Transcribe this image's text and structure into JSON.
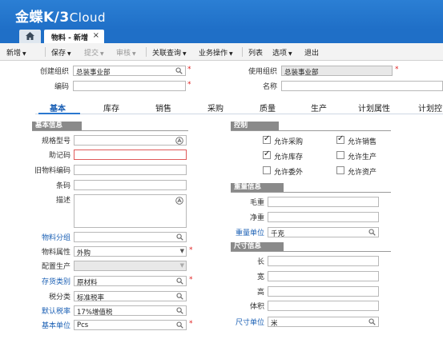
{
  "app": {
    "brand": "金蝶K/3",
    "brand_suffix": "Cloud"
  },
  "tabs": {
    "doc_tab_label": "物料 - 新增",
    "close": "×"
  },
  "toolbar": {
    "items": [
      "新增",
      "保存",
      "提交",
      "审核",
      "关联查询",
      "业务操作",
      "列表",
      "选项",
      "退出"
    ]
  },
  "header": {
    "create_org_label": "创建组织",
    "create_org_value": "总装事业部",
    "use_org_label": "使用组织",
    "use_org_value": "总装事业部",
    "code_label": "编码",
    "code_value": "",
    "name_label": "名称",
    "name_value": ""
  },
  "form_tabs": [
    "基本",
    "库存",
    "销售",
    "采购",
    "质量",
    "生产",
    "计划属性",
    "计划控"
  ],
  "basic": {
    "section_title": "基本信息",
    "spec_label": "规格型号",
    "spec_value": "",
    "mnemonic_label": "助记码",
    "mnemonic_value": "",
    "old_code_label": "旧物料编码",
    "old_code_value": "",
    "barcode_label": "条码",
    "barcode_value": "",
    "desc_label": "描述",
    "desc_value": "",
    "group_label": "物料分组",
    "group_value": "",
    "attr_label": "物料属性",
    "attr_value": "外购",
    "config_label": "配置生产",
    "config_value": "",
    "stock_cat_label": "存货类别",
    "stock_cat_value": "原材料",
    "tax_cat_label": "税分类",
    "tax_cat_value": "标准税率",
    "tax_rate_label": "默认税率",
    "tax_rate_value": "17%增值税",
    "base_unit_label": "基本单位",
    "base_unit_value": "Pcs"
  },
  "control": {
    "section_title": "控制",
    "items": [
      {
        "label": "允许采购",
        "checked": true
      },
      {
        "label": "允许销售",
        "checked": true
      },
      {
        "label": "允许库存",
        "checked": true
      },
      {
        "label": "允许生产",
        "checked": false
      },
      {
        "label": "允许委外",
        "checked": false
      },
      {
        "label": "允许资产",
        "checked": false
      }
    ]
  },
  "weight": {
    "section_title": "重量信息",
    "gross_label": "毛重",
    "gross_value": "",
    "net_label": "净重",
    "net_value": "",
    "unit_label": "重量单位",
    "unit_value": "千克"
  },
  "size": {
    "section_title": "尺寸信息",
    "length_label": "长",
    "length_value": "",
    "width_label": "宽",
    "width_value": "",
    "height_label": "高",
    "height_value": "",
    "volume_label": "体积",
    "volume_value": "",
    "unit_label": "尺寸单位",
    "unit_value": "米"
  },
  "colors": {
    "brand_blue": "#1f6fc7",
    "link_blue": "#1a5fb4",
    "required_red": "#e02020",
    "section_gray": "#8a8a8a"
  }
}
